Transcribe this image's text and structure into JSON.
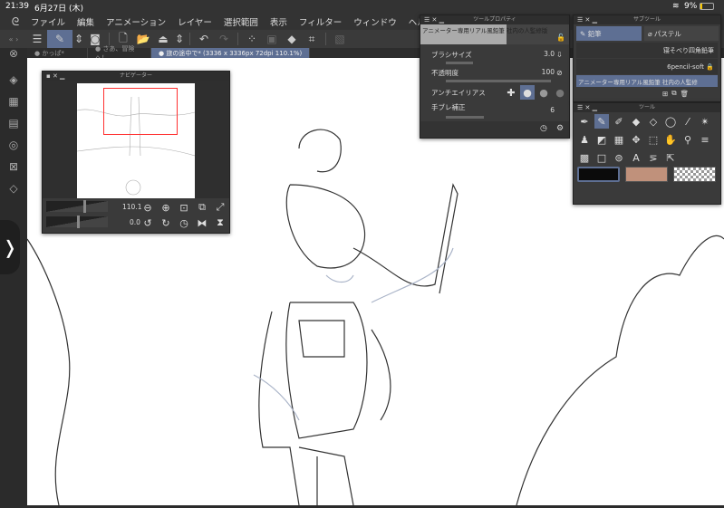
{
  "status": {
    "time": "21:39",
    "date": "6月27日 (木)",
    "battery": "9%"
  },
  "menu": {
    "items": [
      "ファイル",
      "編集",
      "アニメーション",
      "レイヤー",
      "選択範囲",
      "表示",
      "フィルター",
      "ウィンドウ",
      "ヘルプ"
    ]
  },
  "tabs": [
    {
      "label": "● かっぱ*"
    },
    {
      "label": "● さあ、冒険へ！"
    },
    {
      "label": "● 旅の途中で* (3336 x 3336px 72dpi 110.1%)"
    }
  ],
  "navigator": {
    "title": "ナビゲーター",
    "zoom": "110.1",
    "rotation": "0.0"
  },
  "tool_property": {
    "title": "ツールプロパティ",
    "brush_name": "アニメーター専用リアル風鉛筆 社内の人監修版",
    "brush_size_label": "ブラシサイズ",
    "brush_size": "3.0",
    "opacity_label": "不透明度",
    "opacity": "100",
    "antialias_label": "アンチエイリアス",
    "stabilization_label": "手ブレ補正",
    "stabilization": "6"
  },
  "subtool": {
    "title": "サブツール",
    "tabs": [
      "鉛筆",
      "パステル"
    ],
    "items": [
      "寝そべり四角鉛筆",
      "6pencil-soft",
      "アニメーター専用リアル風鉛筆 社内の人監修"
    ]
  },
  "tools": {
    "title": "ツール"
  },
  "colors": {
    "main": "#0b0b0b",
    "sub": "#c0917b",
    "accent": "#5e6f93",
    "selection": "#ff3030"
  }
}
